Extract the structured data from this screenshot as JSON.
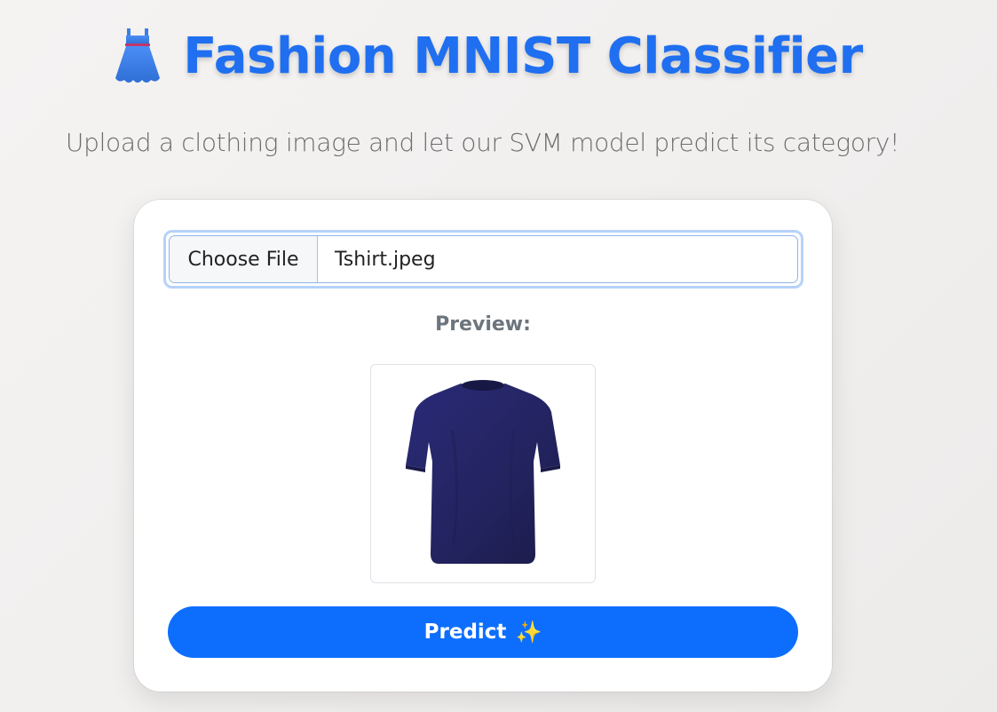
{
  "header": {
    "icon": "dress-icon",
    "title": "Fashion MNIST Classifier",
    "subtitle": "Upload a clothing image and let our SVM model predict its category!"
  },
  "upload": {
    "button_label": "Choose File",
    "file_name": "Tshirt.jpeg"
  },
  "preview": {
    "label": "Preview:",
    "image": "tshirt-image"
  },
  "predict": {
    "label": "Predict",
    "emoji": "✨"
  },
  "colors": {
    "accent": "#0d6efd",
    "title": "#1f6ff0",
    "tshirt": "#25256a"
  }
}
